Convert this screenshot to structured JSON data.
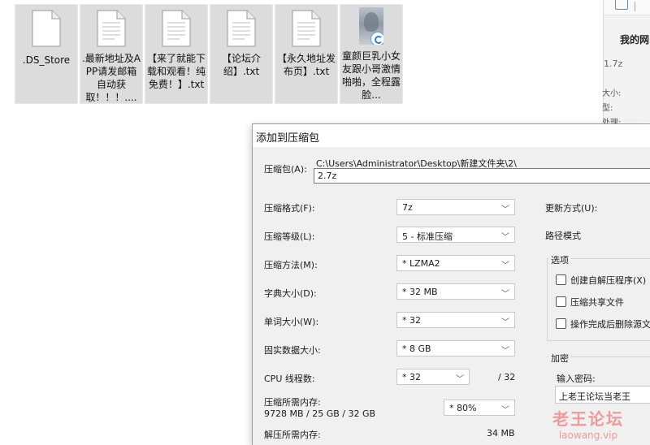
{
  "desktop": {
    "files": [
      {
        "label": ".DS_Store",
        "icon": "document-icon"
      },
      {
        "label": ".最新地址及APP请发邮箱自动获取！！！....",
        "icon": "text-document-icon"
      },
      {
        "label": "【来了就能下载和观看！纯免费！】.txt",
        "icon": "text-document-icon"
      },
      {
        "label": "【论坛介绍】.txt",
        "icon": "text-document-icon"
      },
      {
        "label": "【永久地址发布页】.txt",
        "icon": "text-document-icon"
      },
      {
        "label": "童颜巨乳小女友跟小哥激情啪啪，全程露脸...",
        "icon": "video-thumbnail-icon"
      }
    ]
  },
  "background_panel": {
    "tab": "我的网",
    "version": "1.7z",
    "lines": [
      "大小:",
      "型:",
      "处理:"
    ]
  },
  "dialog": {
    "title": "添加到压缩包",
    "archive_label": "压缩包(A):",
    "archive_path": "C:\\Users\\Administrator\\Desktop\\新建文件夹\\2\\",
    "archive_name": "2.7z",
    "format_label": "压缩格式(F):",
    "format_value": "7z",
    "level_label": "压缩等级(L):",
    "level_value": "5 - 标准压缩",
    "method_label": "压缩方法(M):",
    "method_value": "* LZMA2",
    "dict_label": "字典大小(D):",
    "dict_value": "* 32 MB",
    "word_label": "单词大小(W):",
    "word_value": "* 32",
    "solid_label": "固实数据大小:",
    "solid_value": "* 8 GB",
    "cpu_label": "CPU 线程数:",
    "cpu_value": "* 32",
    "cpu_total": "/ 32",
    "mem_compress_label": "压缩所需内存:",
    "mem_compress_value": "9728 MB / 25 GB / 32 GB",
    "mem_percent_value": "* 80%",
    "mem_decompress_label": "解压所需内存:",
    "mem_decompress_value": "34 MB",
    "update_label": "更新方式(U):",
    "path_mode_label": "路径模式",
    "options_title": "选项",
    "options": [
      "创建自解压程序(X)",
      "压缩共享文件",
      "操作完成后删除源文"
    ],
    "encryption_title": "加密",
    "password_label": "输入密码:",
    "password_value": "上老王论坛当老王"
  },
  "watermark": {
    "line1": "老王论坛",
    "line2": "laowang.vip"
  }
}
